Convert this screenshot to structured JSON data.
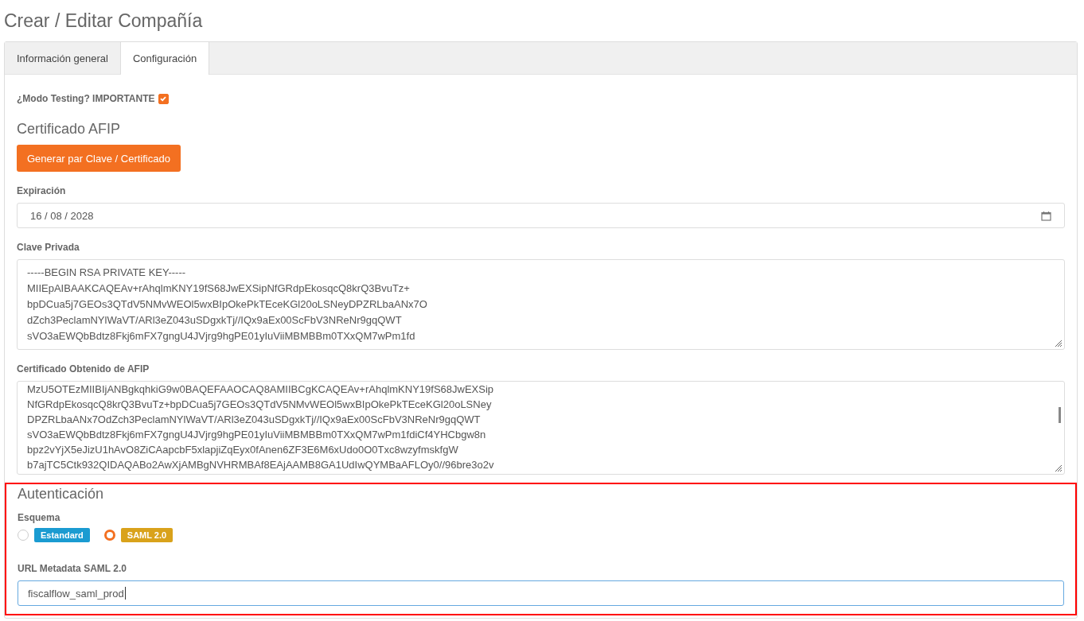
{
  "page_title": "Crear / Editar Compañía",
  "tabs": [
    {
      "label": "Información general",
      "selected": false
    },
    {
      "label": "Configuración",
      "selected": true
    }
  ],
  "testing": {
    "label": "¿Modo Testing? IMPORTANTE",
    "checked": true
  },
  "certificate": {
    "heading": "Certificado AFIP",
    "generate_button": "Generar par Clave / Certificado",
    "expiration": {
      "label": "Expiración",
      "value": "16 / 08 / 2028"
    },
    "private_key": {
      "label": "Clave Privada",
      "lines": [
        "-----BEGIN RSA PRIVATE KEY-----",
        "MIIEpAIBAAKCAQEAv+rAhqlmKNY19fS68JwEXSipNfGRdpEkosqcQ8krQ3BvuTz+",
        "bpDCua5j7GEOs3QTdV5NMvWEOl5wxBIpOkePkTEceKGl20oLSNeyDPZRLbaANx7O",
        "dZch3PeclamNYlWaVT/ARl3eZ043uSDgxkTj//IQx9aEx00ScFbV3NReNr9gqQWT",
        "sVO3aEWQbBdtz8Fkj6mFX7gngU4JVjrg9hgPE01yIuViiMBMBBm0TXxQM7wPm1fd"
      ]
    },
    "certificate": {
      "label": "Certificado Obtenido de AFIP",
      "lines": [
        "MzU5OTEzMIIBIjANBgkqhkiG9w0BAQEFAAOCAQ8AMIIBCgKCAQEAv+rAhqlmKNY19fS68JwEXSip",
        "NfGRdpEkosqcQ8krQ3BvuTz+bpDCua5j7GEOs3QTdV5NMvWEOl5wxBIpOkePkTEceKGl20oLSNey",
        "DPZRLbaANx7OdZch3PeclamNYlWaVT/ARl3eZ043uSDgxkTj//IQx9aEx00ScFbV3NReNr9gqQWT",
        "sVO3aEWQbBdtz8Fkj6mFX7gngU4JVjrg9hgPE01yIuViiMBMBBm0TXxQM7wPm1fdiCf4YHCbgw8n",
        "bpz2vYjX5eJizU1hAvO8ZiCAapcbF5xlapjiZqEyx0fAnen6ZF3E6M6xUdo0O0Txc8wzyfmskfgW",
        "b7ajTC5Ctk932QIDAQABo2AwXjAMBgNVHRMBAf8EAjAAMB8GA1UdIwQYMBaAFLOy0//96bre3o2v"
      ]
    }
  },
  "authentication": {
    "heading": "Autenticación",
    "scheme_label": "Esquema",
    "options": [
      {
        "label": "Estandard",
        "selected": false,
        "color": "#1a9bd1"
      },
      {
        "label": "SAML 2.0",
        "selected": true,
        "color": "#d9a21b"
      }
    ],
    "url_label": "URL Metadata SAML 2.0",
    "url_value": "fiscalflow_saml_prod"
  }
}
